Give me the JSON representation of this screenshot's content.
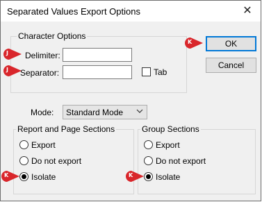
{
  "window": {
    "title": "Separated Values Export Options",
    "close_glyph": "✕"
  },
  "character_options": {
    "legend": "Character Options",
    "delimiter_label": "Delimiter:",
    "delimiter_value": "",
    "separator_label": "Separator:",
    "separator_value": "",
    "tab_label": "Tab",
    "tab_checked": false
  },
  "buttons": {
    "ok": "OK",
    "cancel": "Cancel"
  },
  "mode": {
    "label": "Mode:",
    "selected": "Standard Mode"
  },
  "report_sections": {
    "legend": "Report and Page Sections",
    "options": [
      "Export",
      "Do not export",
      "Isolate"
    ],
    "selected": "Isolate"
  },
  "group_sections": {
    "legend": "Group Sections",
    "options": [
      "Export",
      "Do not export",
      "Isolate"
    ],
    "selected": "Isolate"
  },
  "markers": {
    "delimiter": "J",
    "separator": "J",
    "ok": "K",
    "report_isolate": "K",
    "group_isolate": "K"
  },
  "colors": {
    "marker_red": "#d9262b",
    "accent_blue": "#0078d7"
  }
}
